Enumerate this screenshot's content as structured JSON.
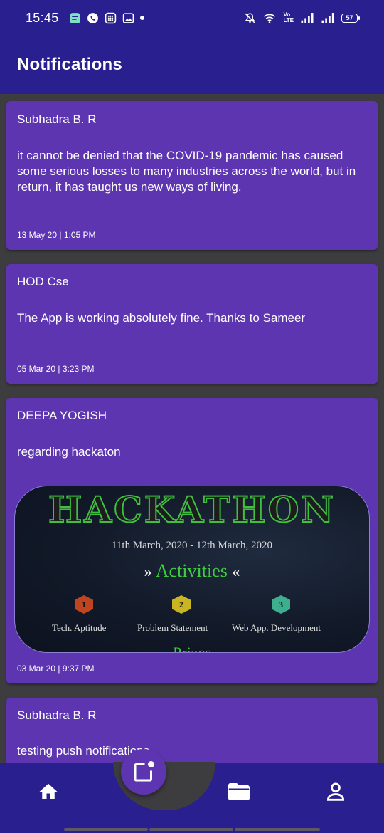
{
  "status_bar": {
    "time": "15:45",
    "battery": "57",
    "network_label_top": "Vo",
    "network_label_bottom": "LTE"
  },
  "app_bar": {
    "title": "Notifications"
  },
  "notifications": [
    {
      "sender": "Subhadra B. R",
      "message": "it cannot be denied that the COVID-19 pandemic has caused some serious losses to many industries across the world, but in return, it has taught us new ways of living.",
      "date": "13 May 20 | 1:05 PM"
    },
    {
      "sender": "HOD Cse",
      "message": "The App is working absolutely fine. Thanks to Sameer",
      "date": "05 Mar 20 | 3:23 PM"
    },
    {
      "sender": "DEEPA YOGISH",
      "message": "regarding hackaton",
      "date": "03 Mar 20 | 9:37 PM",
      "image": {
        "title": "HACKATHON",
        "dates": "11th March, 2020 - 12th March, 2020",
        "section": "Activities",
        "activities": [
          {
            "number": "1",
            "label": "Tech. Aptitude",
            "color": "#c0451f"
          },
          {
            "number": "2",
            "label": "Problem Statement",
            "color": "#c9b422"
          },
          {
            "number": "3",
            "label": "Web App. Development",
            "color": "#3fae8f"
          }
        ],
        "bottom_text": "Prizes"
      }
    },
    {
      "sender": "Subhadra B. R",
      "message": "testing push notifications",
      "date": ""
    }
  ],
  "bottom_nav": {
    "items": [
      {
        "name": "home",
        "icon": "home-icon"
      },
      {
        "name": "notifications",
        "icon": "notification-badge-icon",
        "active": true
      },
      {
        "name": "files",
        "icon": "folder-icon"
      },
      {
        "name": "profile",
        "icon": "person-icon"
      }
    ]
  },
  "colors": {
    "primary_dark": "#2a1f8f",
    "card": "#5e35b1",
    "background": "#3d3c3f",
    "hackathon_green": "#3ccf3c"
  }
}
